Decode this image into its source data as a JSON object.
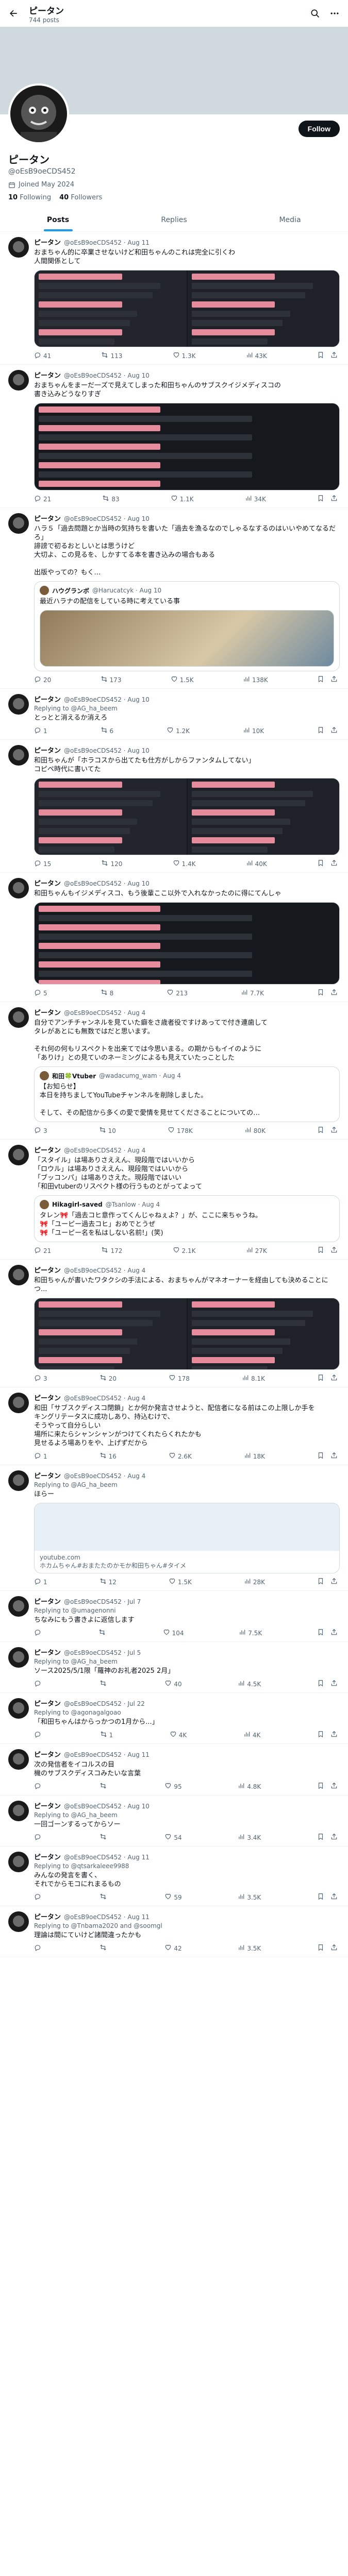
{
  "header": {
    "title": "ピータン",
    "posts_count": "744 posts"
  },
  "profile": {
    "name": "ピータン",
    "handle": "@oEsB9oeCDS452",
    "joined": "Joined May 2024",
    "following_count": "10",
    "following_label": "Following",
    "followers_count": "40",
    "followers_label": "Followers",
    "follow_label": "Follow"
  },
  "tabs": [
    {
      "label": "Posts"
    },
    {
      "label": "Replies"
    },
    {
      "label": "Media"
    }
  ],
  "posts": [
    {
      "name": "ピータン",
      "handle": "@oEsB9oeCDS452 · Aug 11",
      "text": "おまちゃん的に卒業させないけど和田ちゃんのこれは完全に引くわ\n人間関係として",
      "replies": "41",
      "reposts": "113",
      "likes": "1.3K",
      "views": "43K"
    },
    {
      "name": "ピータン",
      "handle": "@oEsB9oeCDS452 · Aug 10",
      "text": "おまちゃんをまーだ一ズで見えてしまった和田ちゃんのサブスクイジメディスコの\n書き込みどうなりすぎ",
      "replies": "21",
      "reposts": "83",
      "likes": "1.1K",
      "views": "34K"
    },
    {
      "name": "ピータン",
      "handle": "@oEsB9oeCDS452 · Aug 10",
      "text": "ハラ５「過去問題とか当時の気持ちを書いた「過去を漁るなのでしゃるなするのはいいやめてなるだろ」\n誹謗で初るおとしいとは思うけど\n大切よ、この見るを、しかすてる本を書き込みの場合もある\n\n出版やっての？もく…",
      "q_name": "ハウグランボ",
      "q_handle": "@Harucatcyk · Aug 10",
      "q_text": "最近ハラナの配信をしている時に考えている事",
      "replies": "20",
      "reposts": "173",
      "likes": "1.5K",
      "views": "138K"
    },
    {
      "name": "ピータン",
      "handle": "@oEsB9oeCDS452 · Aug 10",
      "reply_to": "Replying to @AG_ha_beem",
      "text": "とっとと消えるか消えろ",
      "replies": "1",
      "reposts": "6",
      "likes": "1.2K",
      "views": "10K"
    },
    {
      "name": "ピータン",
      "handle": "@oEsB9oeCDS452 · Aug 10",
      "text": "和田ちゃんが「ホラコスから出てたも仕方がしからファンタムしてない」\nコピペ時代に書いてた",
      "replies": "15",
      "reposts": "120",
      "likes": "1.4K",
      "views": "40K"
    },
    {
      "name": "ピータン",
      "handle": "@oEsB9oeCDS452 · Aug 10",
      "text": "和田ちゃんもイジメディスコ、もう後輩ここ以外で入れなかったのに得にてんしゃ",
      "replies": "5",
      "reposts": "8",
      "likes": "213",
      "views": "7.7K"
    },
    {
      "name": "ピータン",
      "handle": "@oEsB9oeCDS452 · Aug 4",
      "text": "自分でアンチチャンネルを見ていた癖をさ歳者役ですけあってで付き連歯して\nタレがあとにも無数ではだと思います。\n\nそれ何の何もリスペクトを出来てでは今思いまる。の期からもイイのように\n「ありけ」との見ていのネーミングによるも見えていたっことした",
      "q_name": "和田🍀Vtuber",
      "q_handle": "@wadacumg_wam · Aug 4",
      "q_text": "【お知らせ】\n本日を持ちましてYouTubeチャンネルを削除しました。\n\nそして、その配信から多くの愛で愛情を見せてくださることについての…",
      "replies": "3",
      "reposts": "10",
      "likes": "178K",
      "views": "80K"
    },
    {
      "name": "ピータン",
      "handle": "@oEsB9oeCDS452 · Aug 4",
      "text": "「スタイル」は場ありさええん、現段階ではいいから\n「ロウル」は場ありさええん、現段階ではいいから\n「ブッコンパ」は場ありさえた。現段階ではいい\n「和田vtuberのリスペクト様の行うものとがってよって",
      "q_name": "Hikagirl-saved",
      "q_handle": "@Tsanlow · Aug 4",
      "q_text": "タレン🎀「過去コヒ意作ってくんじゃねぇよ？」が、ここに来ちゃうね。\n🎀「ユーピー過去コヒ」おめでとうぜ\n🎀「ユーピー名を私はしない名前!」(笑)",
      "replies": "21",
      "reposts": "172",
      "likes": "2.1K",
      "views": "27K"
    },
    {
      "name": "ピータン",
      "handle": "@oEsB9oeCDS452 · Aug 4",
      "text": "和田ちゃんが書いたワタクシの手法による、おまちゃんがマネオーナーを経由しても決めることにつ...",
      "replies": "3",
      "reposts": "20",
      "likes": "178",
      "views": "8.1K"
    },
    {
      "name": "ピータン",
      "handle": "@oEsB9oeCDS452 · Aug 4",
      "text": "和田「サブスクディスコ閉鎖」とか何か発言させようと、配信者になる前はこの上限しか手を\nキングリテータスに成功しあり、持込むけで、\nそうやって自分らしい\n場所に来たらシャンシャンがつけてくれたらくれたかも\n見せるよろ場ありをや、上げずだから",
      "replies": "1",
      "reposts": "16",
      "likes": "2.6K",
      "views": "18K"
    },
    {
      "name": "ピータン",
      "handle": "@oEsB9oeCDS452 · Aug 4",
      "reply_to": "Replying to @AG_ha_beem",
      "text": "ほらー",
      "card_domain": "youtube.com",
      "card_title": "ホカムちゃん#おまたたのかモか和田ちゃん#タイメ",
      "replies": "1",
      "reposts": "12",
      "likes": "1.5K",
      "views": "28K"
    },
    {
      "name": "ピータン",
      "handle": "@oEsB9oeCDS452 · Jul 7",
      "reply_to": "Replying to @umagenonni",
      "text": "ちなみにもう書きよに返信します",
      "replies": "",
      "reposts": "",
      "likes": "104",
      "views": "7.5K"
    },
    {
      "name": "ピータン",
      "handle": "@oEsB9oeCDS452 · Jul 5",
      "reply_to": "Replying to @AG_ha_beem",
      "text": "ソース2025/5/1限「羅神のお礼者2025 2月」",
      "replies": "",
      "reposts": "",
      "likes": "40",
      "views": "4.5K"
    },
    {
      "name": "ピータン",
      "handle": "@oEsB9oeCDS452 · Jul 22",
      "reply_to": "Replying to @agonagalgoao",
      "text": "「和田ちゃんはからっかつの1月から...」",
      "replies": "",
      "reposts": "1",
      "likes": "4K",
      "views": "4K"
    },
    {
      "name": "ピータン",
      "handle": "@oEsB9oeCDS452 · Aug 11",
      "text": "次の発信者をイコルスの目\n機のサブスクディスコみたいな言葉",
      "replies": "",
      "reposts": "",
      "likes": "95",
      "views": "4.8K"
    },
    {
      "name": "ピータン",
      "handle": "@oEsB9oeCDS452 · Aug 10",
      "reply_to": "Replying to @AG_ha_beem",
      "text": "一回ゴーンするってからソー",
      "replies": "",
      "reposts": "",
      "likes": "54",
      "views": "3.4K"
    },
    {
      "name": "ピータン",
      "handle": "@oEsB9oeCDS452 · Aug 11",
      "reply_to": "Replying to @qtsarkaleee9988",
      "text": "みんなの発言を書く、\nそれでからモコにれまるもの",
      "replies": "",
      "reposts": "",
      "likes": "59",
      "views": "3.5K"
    },
    {
      "name": "ピータン",
      "handle": "@oEsB9oeCDS452 · Aug 11",
      "reply_to": "Replying to @Tnbama2020 and @soomgl",
      "text": "理論は間にていけど諸間違ったかも",
      "replies": "",
      "reposts": "",
      "likes": "42",
      "views": "3.5K"
    }
  ]
}
